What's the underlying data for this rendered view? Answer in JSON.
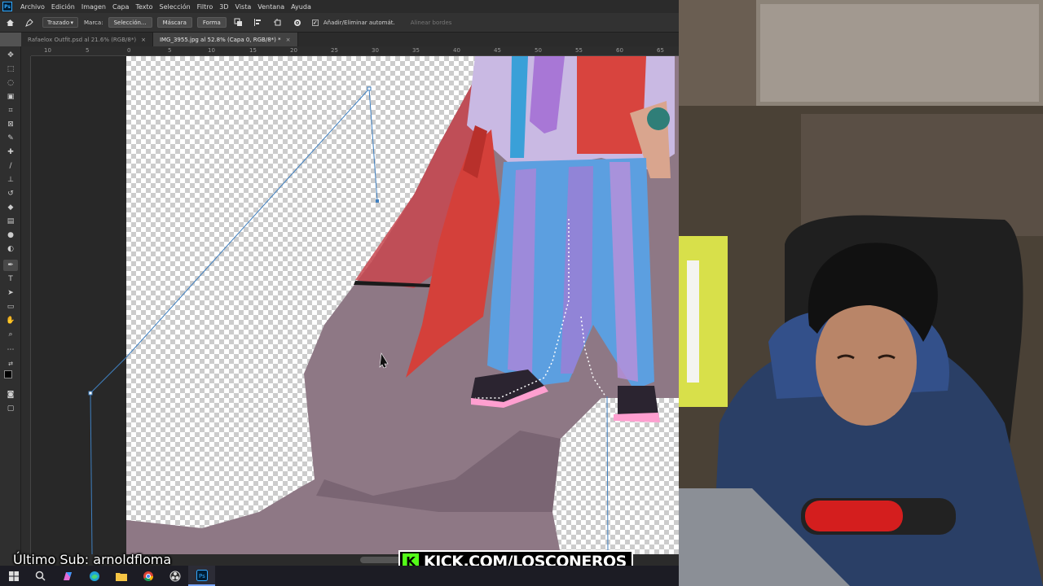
{
  "menubar": {
    "app_icon": "Ps",
    "items": [
      "Archivo",
      "Edición",
      "Imagen",
      "Capa",
      "Texto",
      "Selección",
      "Filtro",
      "3D",
      "Vista",
      "Ventana",
      "Ayuda"
    ]
  },
  "options_bar": {
    "mode_select": "Trazado",
    "marca_label": "Marca:",
    "seleccion_button": "Selección...",
    "mascara_button": "Máscara",
    "forma_button": "Forma",
    "auto_add_delete_label": "Añadir/Eliminar automát.",
    "auto_add_delete_checked": true,
    "align_edges_label": "Alinear bordes"
  },
  "document_tabs": [
    {
      "label": "Rafaelox Outfit.psd al 21.6% (RGB/8*)",
      "active": false
    },
    {
      "label": "IMG_3955.jpg al 52.8% (Capa 0, RGB/8*) *",
      "active": true
    }
  ],
  "rulers": {
    "horizontal": [
      "10",
      "5",
      "0",
      "5",
      "10",
      "15",
      "20",
      "25",
      "30",
      "35",
      "40",
      "45",
      "50",
      "55",
      "60",
      "65"
    ]
  },
  "tools": [
    "move-icon",
    "marquee-icon",
    "lasso-icon",
    "object-select-icon",
    "crop-icon",
    "frame-icon",
    "eyedropper-icon",
    "healing-icon",
    "brush-icon",
    "stamp-icon",
    "history-brush-icon",
    "eraser-icon",
    "gradient-icon",
    "blur-icon",
    "dodge-icon",
    "pen-icon",
    "type-icon",
    "path-select-icon",
    "rectangle-icon",
    "hand-icon",
    "zoom-icon",
    "more-icon",
    "swap-colors-icon",
    "foreground-color",
    "quick-mask-icon",
    "screen-mode-icon"
  ],
  "colors": {
    "foreground": "#000000",
    "background": "#ffffff",
    "path_line": "#3f7fbf",
    "kick_green": "#53fc18"
  },
  "overlay": {
    "last_sub": "Último Sub: arnoldfloma",
    "kick_url": "KICK.COM/LOSCONEROS",
    "kick_logo": "K"
  },
  "taskbar": [
    "windows-icon",
    "search-icon",
    "copilot-icon",
    "edge-icon",
    "file-explorer-icon",
    "chrome-icon",
    "obs-icon",
    "photoshop-icon"
  ]
}
